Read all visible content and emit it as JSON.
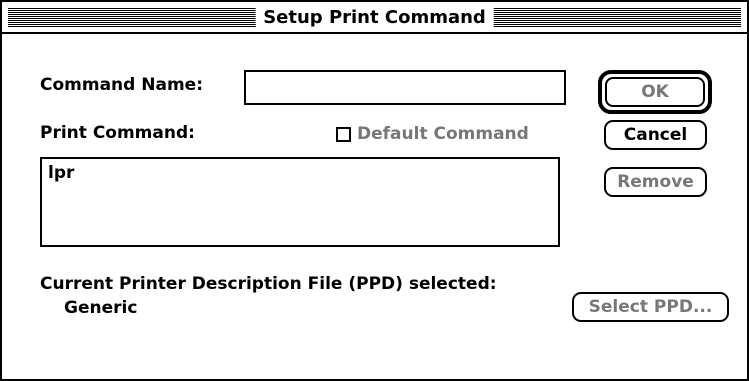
{
  "window": {
    "title": "Setup Print Command"
  },
  "form": {
    "command_name_label": "Command Name:",
    "command_name_value": "",
    "print_command_label": "Print Command:",
    "default_command_label": "Default Command",
    "default_command_checked": false,
    "print_command_value": "lpr",
    "ppd_label": "Current Printer Description File (PPD) selected:",
    "ppd_value": "Generic"
  },
  "buttons": {
    "ok": "OK",
    "cancel": "Cancel",
    "remove": "Remove",
    "select_ppd": "Select PPD..."
  }
}
